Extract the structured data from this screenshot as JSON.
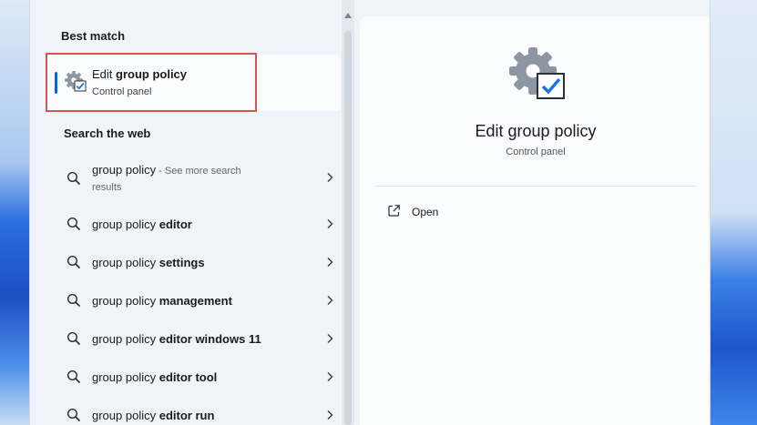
{
  "best_match": {
    "heading": "Best match",
    "app": {
      "title_prefix": "Edit ",
      "title_bold": "group policy",
      "subtitle": "Control panel",
      "icon": "gear-checkbox-icon"
    }
  },
  "web": {
    "heading": "Search the web",
    "items": [
      {
        "query": "group policy",
        "bold": "",
        "suffix": " - See more search",
        "suffix_line2": "results"
      },
      {
        "query": "group policy ",
        "bold": "editor"
      },
      {
        "query": "group policy ",
        "bold": "settings"
      },
      {
        "query": "group policy ",
        "bold": "management"
      },
      {
        "query": "group policy ",
        "bold": "editor windows 11"
      },
      {
        "query": "group policy ",
        "bold": "editor tool"
      },
      {
        "query": "group policy ",
        "bold": "editor run"
      }
    ]
  },
  "preview": {
    "title": "Edit group policy",
    "subtitle": "Control panel",
    "actions": [
      {
        "label": "Open",
        "icon": "open-external-icon"
      }
    ]
  },
  "colors": {
    "accent": "#1565c0",
    "highlight": "#d9534f",
    "checkbox": "#1a73e8"
  }
}
